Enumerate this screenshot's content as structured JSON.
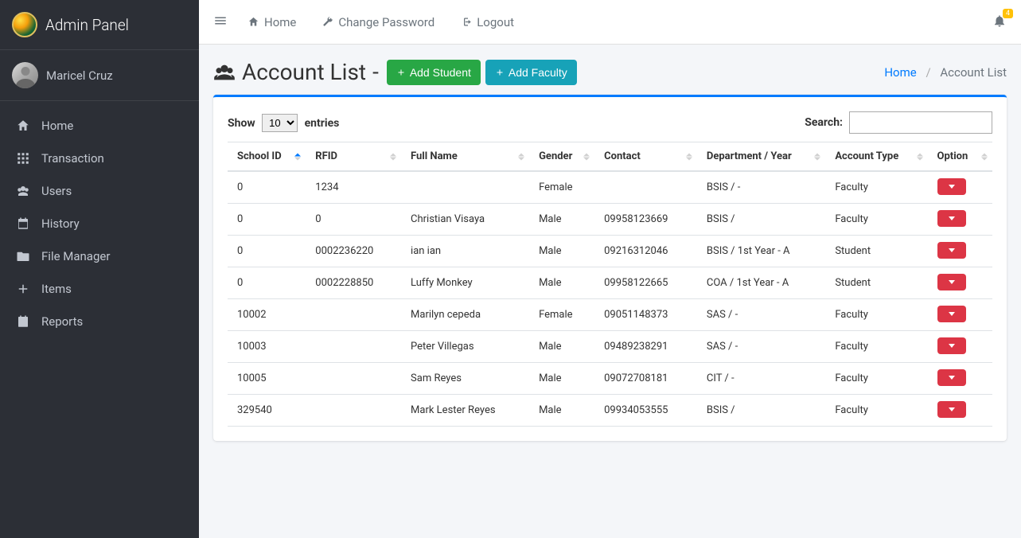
{
  "brand": "Admin Panel",
  "user": {
    "name": "Maricel Cruz"
  },
  "sidebar": {
    "items": [
      {
        "label": "Home",
        "icon": "home"
      },
      {
        "label": "Transaction",
        "icon": "grid"
      },
      {
        "label": "Users",
        "icon": "users"
      },
      {
        "label": "History",
        "icon": "calendar"
      },
      {
        "label": "File Manager",
        "icon": "folder"
      },
      {
        "label": "Items",
        "icon": "plus"
      },
      {
        "label": "Reports",
        "icon": "report"
      }
    ]
  },
  "topbar": {
    "home": "Home",
    "change_password": "Change Password",
    "logout": "Logout",
    "notification_count": "4"
  },
  "page": {
    "title": "Account List",
    "add_student": "Add Student",
    "add_faculty": "Add Faculty"
  },
  "breadcrumb": {
    "home": "Home",
    "current": "Account List",
    "sep": "/"
  },
  "datatable": {
    "show_prefix": "Show",
    "show_suffix": "entries",
    "per_page": "10",
    "search_label": "Search:",
    "columns": [
      "School ID",
      "RFID",
      "Full Name",
      "Gender",
      "Contact",
      "Department / Year",
      "Account Type",
      "Option"
    ],
    "rows": [
      {
        "school_id": "0",
        "rfid": "1234",
        "full_name": "",
        "gender": "Female",
        "contact": "",
        "dept": "BSIS / -",
        "type": "Faculty"
      },
      {
        "school_id": "0",
        "rfid": "0",
        "full_name": "Christian Visaya",
        "gender": "Male",
        "contact": "09958123669",
        "dept": "BSIS /",
        "type": "Faculty"
      },
      {
        "school_id": "0",
        "rfid": "0002236220",
        "full_name": "ian ian",
        "gender": "Male",
        "contact": "09216312046",
        "dept": "BSIS / 1st Year - A",
        "type": "Student"
      },
      {
        "school_id": "0",
        "rfid": "0002228850",
        "full_name": "Luffy Monkey",
        "gender": "Male",
        "contact": "09958122665",
        "dept": "COA / 1st Year - A",
        "type": "Student"
      },
      {
        "school_id": "10002",
        "rfid": "",
        "full_name": "Marilyn cepeda",
        "gender": "Female",
        "contact": "09051148373",
        "dept": "SAS / -",
        "type": "Faculty"
      },
      {
        "school_id": "10003",
        "rfid": "",
        "full_name": "Peter Villegas",
        "gender": "Male",
        "contact": "09489238291",
        "dept": "SAS / -",
        "type": "Faculty"
      },
      {
        "school_id": "10005",
        "rfid": "",
        "full_name": "Sam Reyes",
        "gender": "Male",
        "contact": "09072708181",
        "dept": "CIT / -",
        "type": "Faculty"
      },
      {
        "school_id": "329540",
        "rfid": "",
        "full_name": "Mark Lester Reyes",
        "gender": "Male",
        "contact": "09934053555",
        "dept": "BSIS /",
        "type": "Faculty"
      }
    ]
  }
}
